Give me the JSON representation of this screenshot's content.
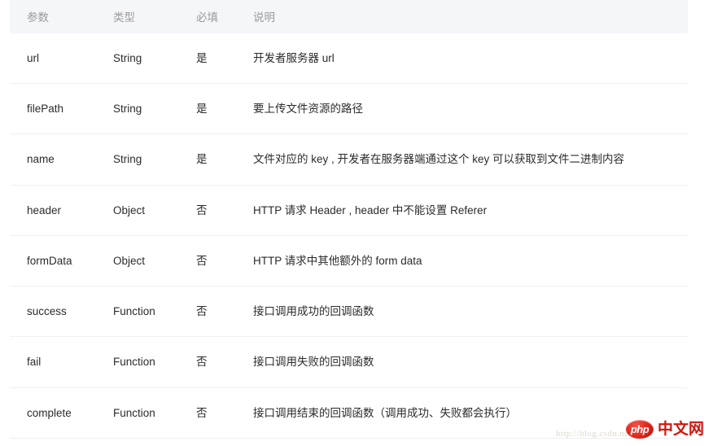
{
  "table": {
    "headers": [
      {
        "key": "param",
        "label": "参数"
      },
      {
        "key": "type",
        "label": "类型"
      },
      {
        "key": "required",
        "label": "必填"
      },
      {
        "key": "desc",
        "label": "说明"
      }
    ],
    "rows": [
      {
        "param": "url",
        "type": "String",
        "required": "是",
        "desc": "开发者服务器 url"
      },
      {
        "param": "filePath",
        "type": "String",
        "required": "是",
        "desc": "要上传文件资源的路径"
      },
      {
        "param": "name",
        "type": "String",
        "required": "是",
        "desc": "文件对应的 key , 开发者在服务器端通过这个 key 可以获取到文件二进制内容"
      },
      {
        "param": "header",
        "type": "Object",
        "required": "否",
        "desc": "HTTP 请求 Header , header 中不能设置 Referer"
      },
      {
        "param": "formData",
        "type": "Object",
        "required": "否",
        "desc": "HTTP 请求中其他额外的 form data"
      },
      {
        "param": "success",
        "type": "Function",
        "required": "否",
        "desc": "接口调用成功的回调函数"
      },
      {
        "param": "fail",
        "type": "Function",
        "required": "否",
        "desc": "接口调用失败的回调函数"
      },
      {
        "param": "complete",
        "type": "Function",
        "required": "否",
        "desc": "接口调用结束的回调函数（调用成功、失败都会执行）"
      }
    ]
  },
  "watermark": {
    "url": "http://blog.csdn.net/",
    "brand_badge": "php",
    "brand_name": "中文网"
  },
  "colors": {
    "header_bg": "#f5f6f8",
    "header_text": "#9b9b9b",
    "body_text": "#2b2b2b",
    "row_border": "#f0f0f2",
    "brand_red": "#d3150c"
  }
}
